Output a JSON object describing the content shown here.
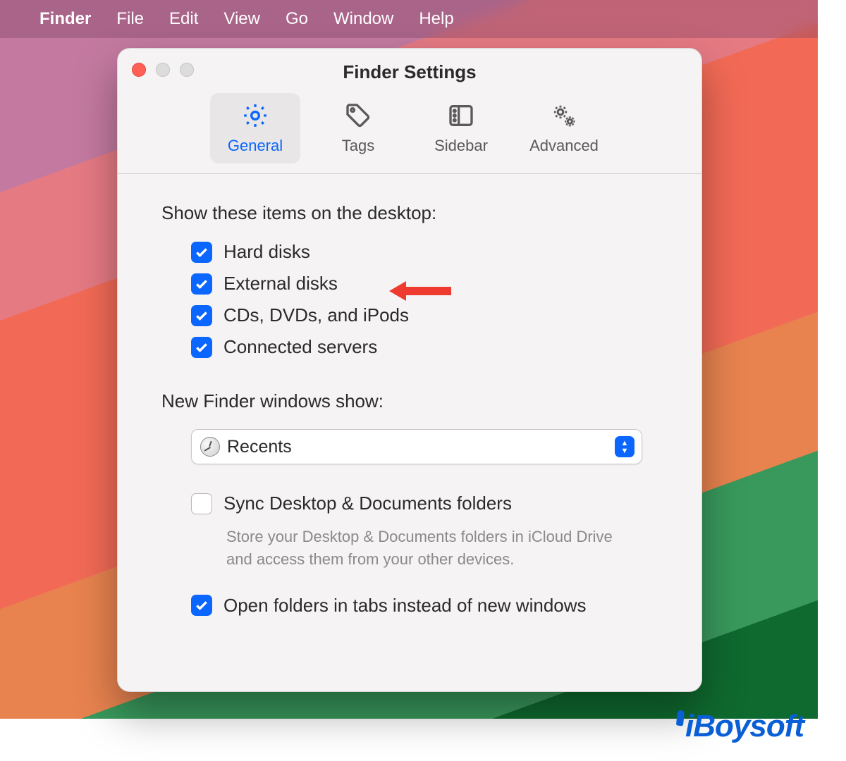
{
  "menubar": {
    "app_name": "Finder",
    "items": [
      "File",
      "Edit",
      "View",
      "Go",
      "Window",
      "Help"
    ]
  },
  "window": {
    "title": "Finder Settings",
    "tabs": {
      "general": "General",
      "tags": "Tags",
      "sidebar": "Sidebar",
      "advanced": "Advanced",
      "selected": "general"
    }
  },
  "general": {
    "show_items_label": "Show these items on the desktop:",
    "items": [
      {
        "label": "Hard disks",
        "checked": true
      },
      {
        "label": "External disks",
        "checked": true
      },
      {
        "label": "CDs, DVDs, and iPods",
        "checked": true
      },
      {
        "label": "Connected servers",
        "checked": true
      }
    ],
    "new_windows_label": "New Finder windows show:",
    "new_windows_value": "Recents",
    "sync_label": "Sync Desktop & Documents folders",
    "sync_checked": false,
    "sync_desc": "Store your Desktop & Documents folders in iCloud Drive and access them from your other devices.",
    "open_tabs_label": "Open folders in tabs instead of new windows",
    "open_tabs_checked": true
  },
  "annotation": {
    "arrow_target": "External disks"
  },
  "watermark": "iBoysoft"
}
